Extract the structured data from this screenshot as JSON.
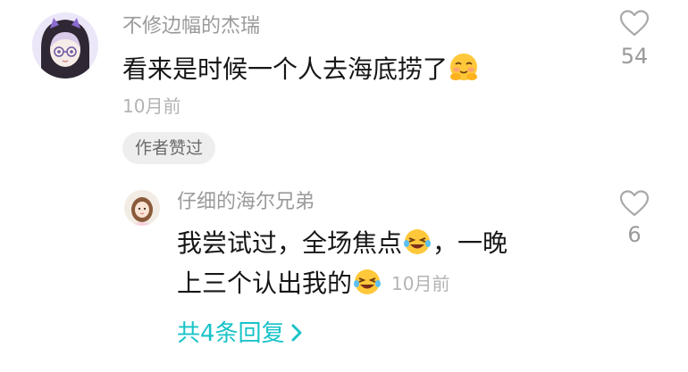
{
  "comment": {
    "username": "不修边幅的杰瑞",
    "text": "看来是时候一个人去海底捞了",
    "time": "10月前",
    "author_badge": "作者赞过",
    "like_count": "54"
  },
  "reply": {
    "username": "仔细的海尔兄弟",
    "text_line1_a": "我尝试过，全场焦点",
    "text_line1_b": "，一晚",
    "text_line2": "上三个认出我的",
    "time": "10月前",
    "like_count": "6"
  },
  "view_replies": {
    "label": "共4条回复"
  },
  "colors": {
    "accent": "#18c3c8",
    "muted": "#9a9a9a",
    "text": "#161616"
  },
  "icons": {
    "like": "heart-outline-icon",
    "emoji_main": "blushing-hug-emoji",
    "emoji_laugh": "rolling-laugh-emoji",
    "chevron": "chevron-right-icon"
  }
}
